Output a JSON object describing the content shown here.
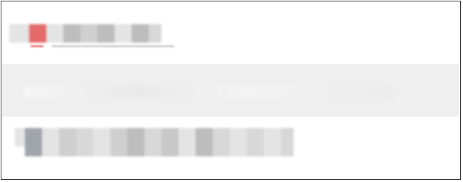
{
  "menu": {
    "items": [
      {
        "label": "",
        "selected": false
      },
      {
        "label": "",
        "selected": true
      },
      {
        "label": "",
        "selected": false
      }
    ]
  },
  "colors": {
    "accent": "#e46a6a",
    "highlight_bg": "#efefef",
    "border": "#333333"
  }
}
